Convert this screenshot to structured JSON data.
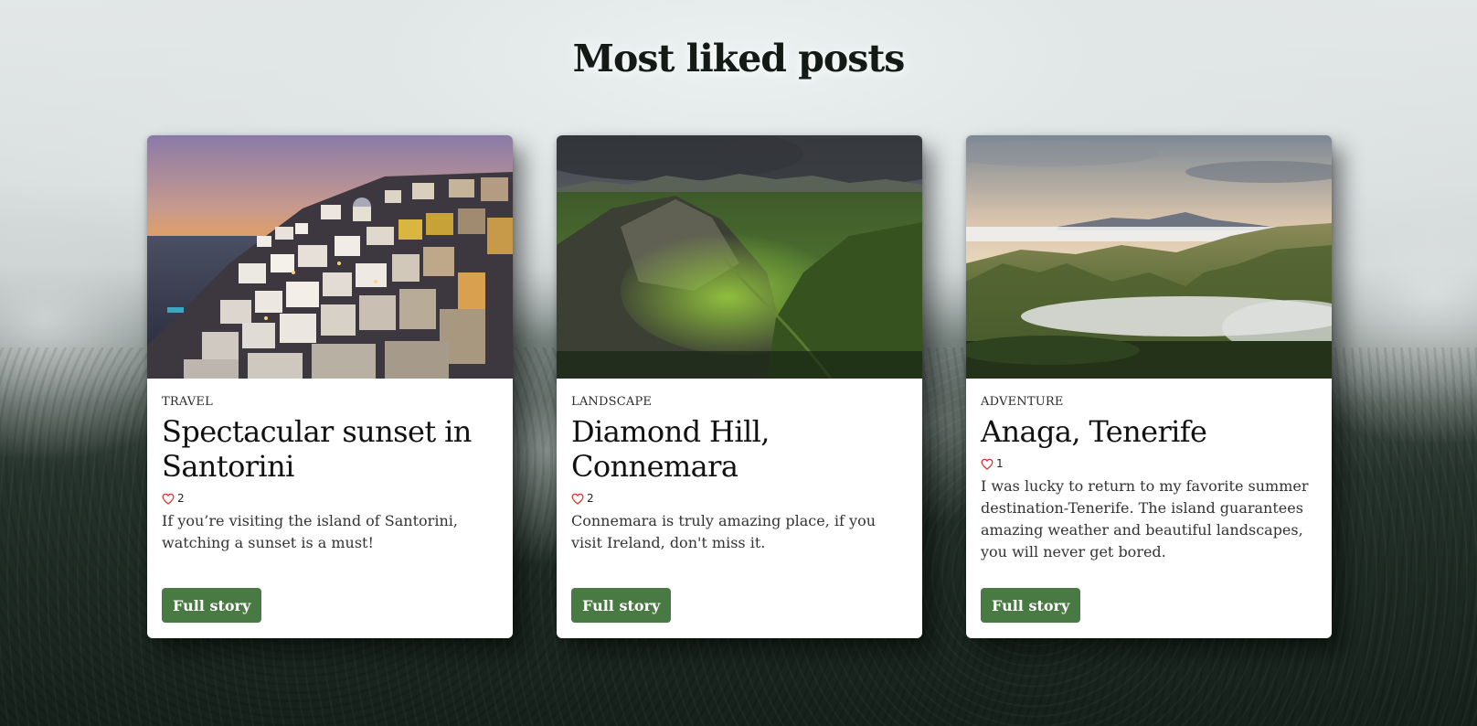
{
  "page": {
    "title": "Most liked posts"
  },
  "posts": [
    {
      "category": "TRAVEL",
      "title": "Spectacular sunset in Santorini",
      "likes": "2",
      "excerpt": "If you’re visiting the island of Santorini, watching a sunset is a must!",
      "button_label": "Full story",
      "image": "santorini-sunset-photo"
    },
    {
      "category": "LANDSCAPE",
      "title": "Diamond Hill, Connemara",
      "likes": "2",
      "excerpt": "Connemara is truly amazing place, if you visit Ireland, don't miss it.",
      "button_label": "Full story",
      "image": "connemara-hills-photo"
    },
    {
      "category": "ADVENTURE",
      "title": "Anaga, Tenerife",
      "likes": "1",
      "excerpt": "I was lucky to return to my favorite summer destination-Tenerife. The island guarantees amazing weather and beautiful landscapes, you will never get bored.",
      "button_label": "Full story",
      "image": "tenerife-mountains-photo"
    }
  ],
  "colors": {
    "button": "#4a7a43",
    "heart": "#d9342b",
    "title": "#141a16"
  },
  "icons": {
    "like": "heart-outline-icon"
  }
}
